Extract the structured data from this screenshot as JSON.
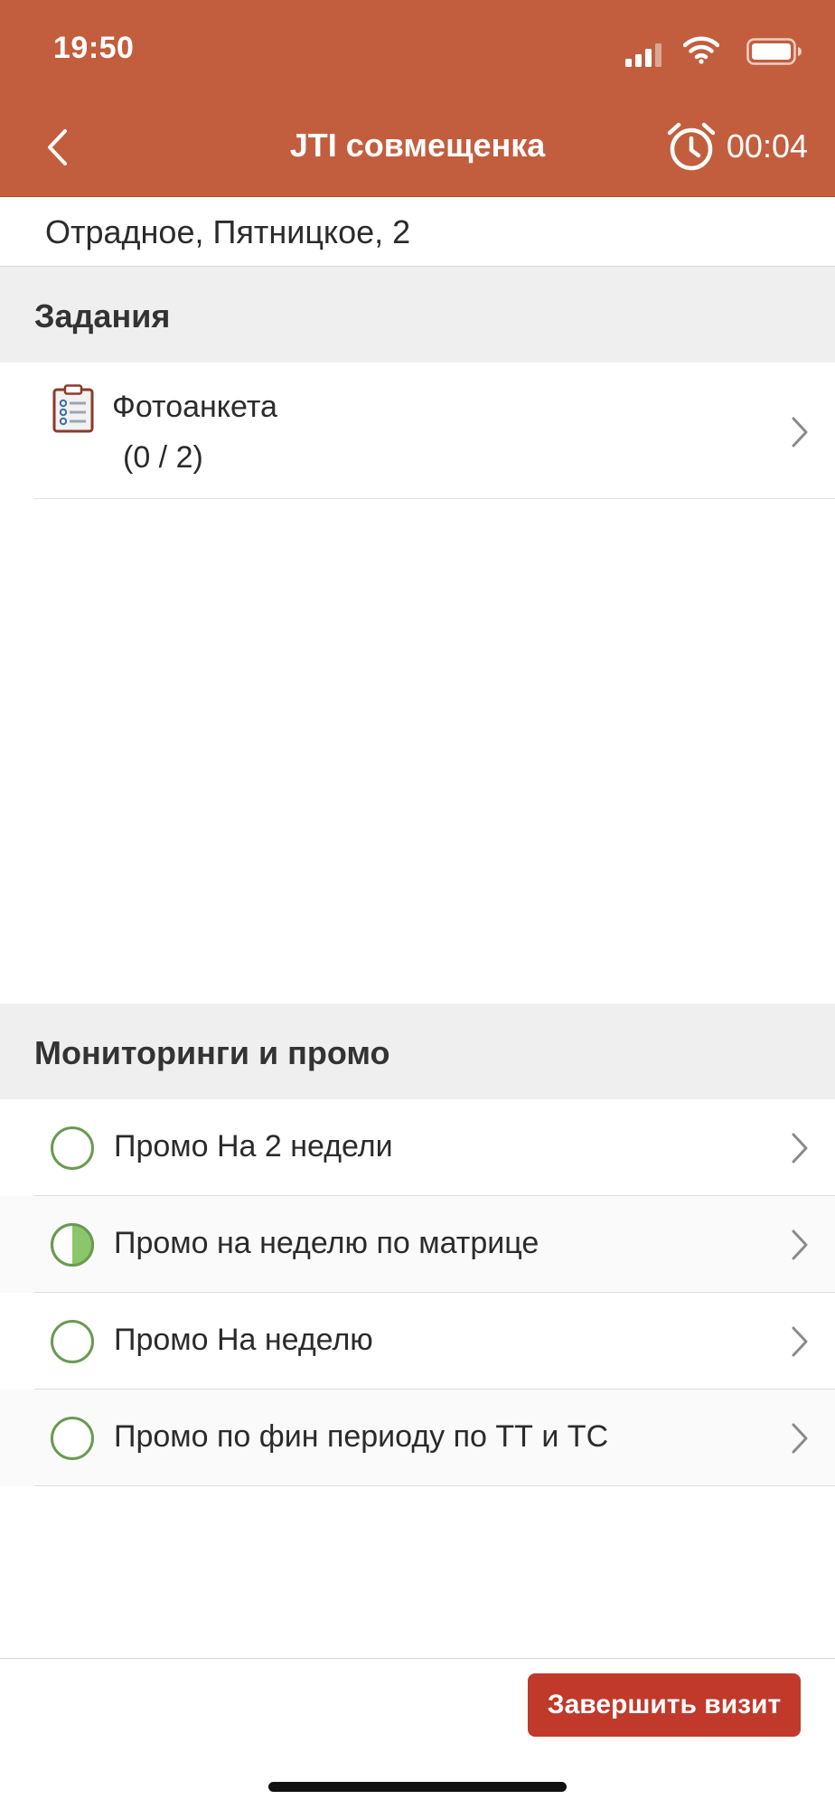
{
  "status_bar": {
    "time": "19:50"
  },
  "nav": {
    "title": "JTI совмещенка",
    "timer": "00:04"
  },
  "address": "Отрадное, Пятницкое, 2",
  "tasks_section": {
    "header": "Задания",
    "items": [
      {
        "title": "Фотоанкета",
        "count": "(0 / 2)",
        "icon": "clipboard-icon"
      }
    ]
  },
  "promo_section": {
    "header": "Мониторинги и промо",
    "items": [
      {
        "label": "Промо На 2 недели",
        "status": "empty"
      },
      {
        "label": "Промо на неделю по матрице",
        "status": "half"
      },
      {
        "label": "Промо На неделю",
        "status": "empty"
      },
      {
        "label": "Промо по фин периоду по ТТ и ТС",
        "status": "empty"
      }
    ]
  },
  "footer": {
    "finish_label": "Завершить визит"
  },
  "colors": {
    "brand": "#c25e3e",
    "button": "#c0392b",
    "status_green": "#6a9a52",
    "status_fill": "#8bc76a"
  }
}
